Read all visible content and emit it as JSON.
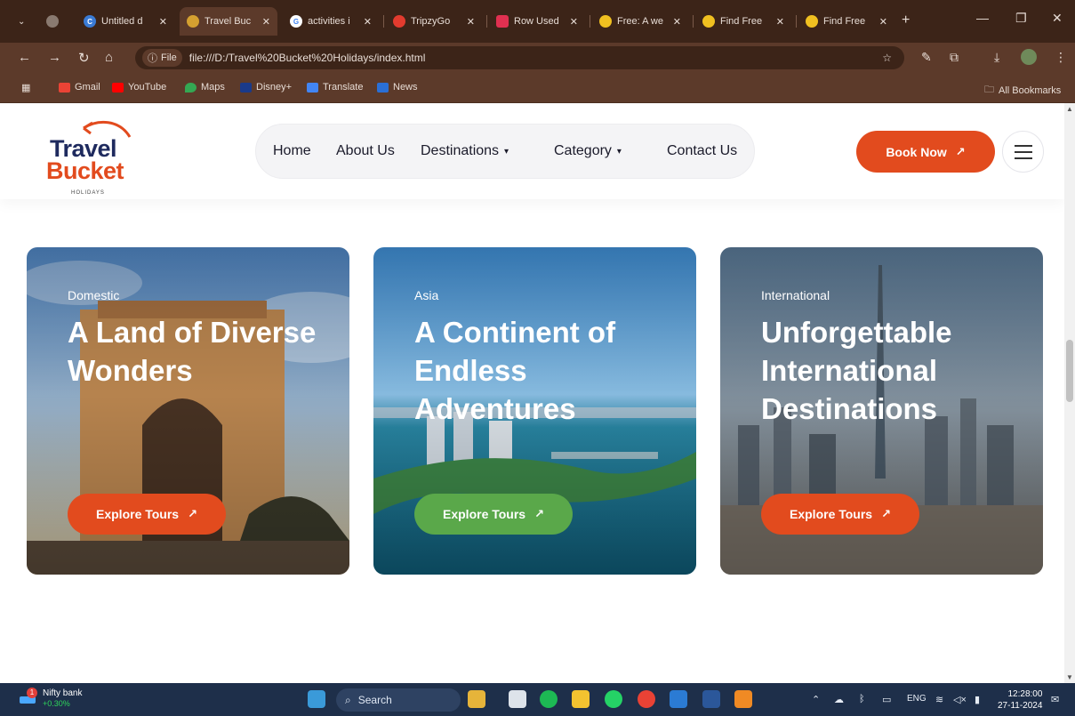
{
  "browser": {
    "tabs": [
      {
        "label": "Untitled d",
        "active": false
      },
      {
        "label": "Travel Buc",
        "active": true
      },
      {
        "label": "activities i",
        "active": false
      },
      {
        "label": "TripzyGo",
        "active": false
      },
      {
        "label": "Row Used",
        "active": false
      },
      {
        "label": "Free: A we",
        "active": false
      },
      {
        "label": "Find Free",
        "active": false
      },
      {
        "label": "Find Free",
        "active": false
      }
    ],
    "new_tab": "+",
    "address": "file:///D:/Travel%20Bucket%20Holidays/index.html",
    "file_chip": "File",
    "bookmarks": [
      "Gmail",
      "YouTube",
      "Maps",
      "Disney+",
      "Translate",
      "News"
    ],
    "all_bookmarks": "All Bookmarks"
  },
  "site": {
    "logo": {
      "line1": "Travel",
      "line2": "Bucket",
      "line3": "HOLIDAYS"
    },
    "nav": [
      {
        "label": "Home",
        "chevron": false
      },
      {
        "label": "About Us",
        "chevron": false
      },
      {
        "label": "Destinations",
        "chevron": true
      },
      {
        "label": "Category",
        "chevron": true
      },
      {
        "label": "Contact Us",
        "chevron": false
      }
    ],
    "book_now": "Book Now",
    "cards": [
      {
        "kicker": "Domestic",
        "title": "A Land of Diverse Wonders",
        "button": "Explore Tours",
        "button_color": "#e24b1e"
      },
      {
        "kicker": "Asia",
        "title": "A Continent of Endless Adventures",
        "button": "Explore Tours",
        "button_color": "#5aa84a"
      },
      {
        "kicker": "International",
        "title": "Unforgettable International Destinations",
        "button": "Explore Tours",
        "button_color": "#e24b1e"
      }
    ]
  },
  "taskbar": {
    "stock_name": "Nifty bank",
    "stock_change": "+0.30%",
    "stock_badge": "1",
    "search": "Search",
    "lang": "ENG",
    "time": "12:28:00",
    "date": "27-11-2024"
  },
  "colors": {
    "accent": "#e24b1e",
    "navy": "#1e2a5e",
    "green": "#5aa84a"
  }
}
